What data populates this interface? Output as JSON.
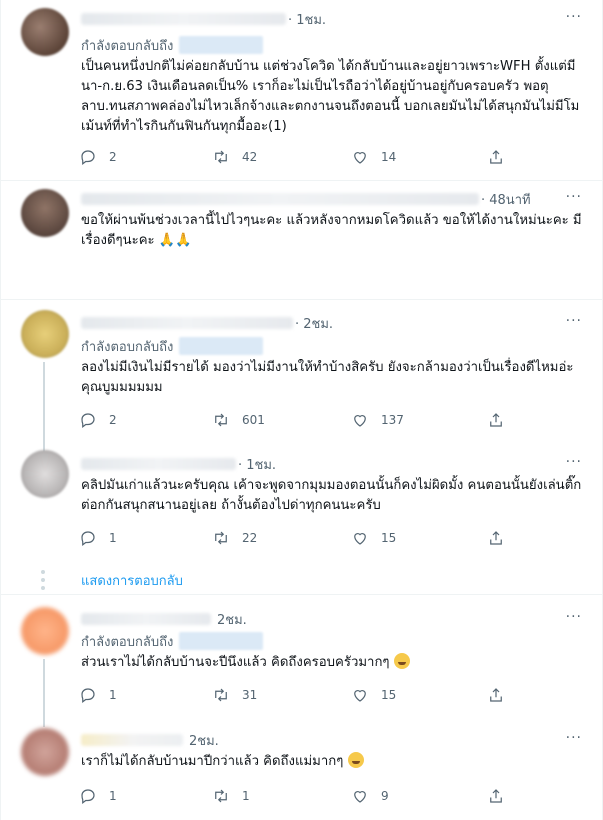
{
  "tweets": [
    {
      "time": "· 1ชม.",
      "reply_label": "กำลังตอบกลับถึง",
      "text": "เป็นคนหนึ่งปกติไม่ค่อยกลับบ้าน แต่ช่วงโควิด ได้กลับบ้านและอยู่ยาวเพราะWFH ตั้งแต่มีนา-ก.ย.63 เงินเดือนลดเป็น% เราก็อะไม่เป็นไรถือว่าได้อยู่บ้านอยู่กับครอบครัว พอตุลาบ.ทนสภาพคล่องไม่ไหวเล็กจ้างและตกงานจนถึงตอนนี้ บอกเลยมันไม่ได้สนุกมันไม่มีโมเม้นท์ที่ทำไรกินกันฟินกันทุกมื้ออะ(1)",
      "replies": "2",
      "retweets": "42",
      "likes": "14"
    },
    {
      "time": "· 48นาที",
      "text": "ขอให้ผ่านพ้นช่วงเวลานี้ไปไวๆนะคะ แล้วหลังจากหมดโควิดแล้ว ขอให้ได้งานใหม่นะคะ มีเรื่องดีๆนะคะ 🙏🙏"
    },
    {
      "time": "· 2ชม.",
      "reply_label": "กำลังตอบกลับถึง",
      "text": "ลองไม่มีเงินไม่มีรายได้ มองว่าไม่มีงานให้ทำบ้างสิครับ ยังจะกล้ามองว่าเป็นเรื่องดีไหมอ่ะคุณบูมมมมมม",
      "replies": "2",
      "retweets": "601",
      "likes": "137"
    },
    {
      "time": "· 1ชม.",
      "text": "คลิปมันเก่าแล้วนะครับคุณ เค้าจะพูดจากมุมมองตอนนั้นก็คงไม่ผิดมั้ง คนตอนนั้นยังเล่นติ๊กต่อกกันสนุกสนานอยู่เลย ถ้างั้นต้องไปด่าทุกคนนะครับ",
      "replies": "1",
      "retweets": "22",
      "likes": "15"
    },
    {
      "time": "2ชม.",
      "reply_label": "กำลังตอบกลับถึง",
      "text": "ส่วนเราไม่ได้กลับบ้านจะปีนึงแล้ว คิดถึงครอบครัวมากๆ",
      "replies": "1",
      "retweets": "31",
      "likes": "15"
    },
    {
      "time": "2ชม.",
      "text": "เราก็ไม่ได้กลับบ้านมาปีกว่าแล้ว คิดถึงแม่มากๆ",
      "replies": "1",
      "retweets": "1",
      "likes": "9"
    }
  ],
  "show_replies": "แสดงการตอบกลับ",
  "more_label": "···",
  "icons": [
    "reply-icon",
    "retweet-icon",
    "like-icon",
    "share-icon",
    "more-icon"
  ],
  "colors": {
    "accent": "#1d9bf0",
    "muted": "#536471",
    "text": "#0f1419",
    "divider": "#eff3f4"
  }
}
